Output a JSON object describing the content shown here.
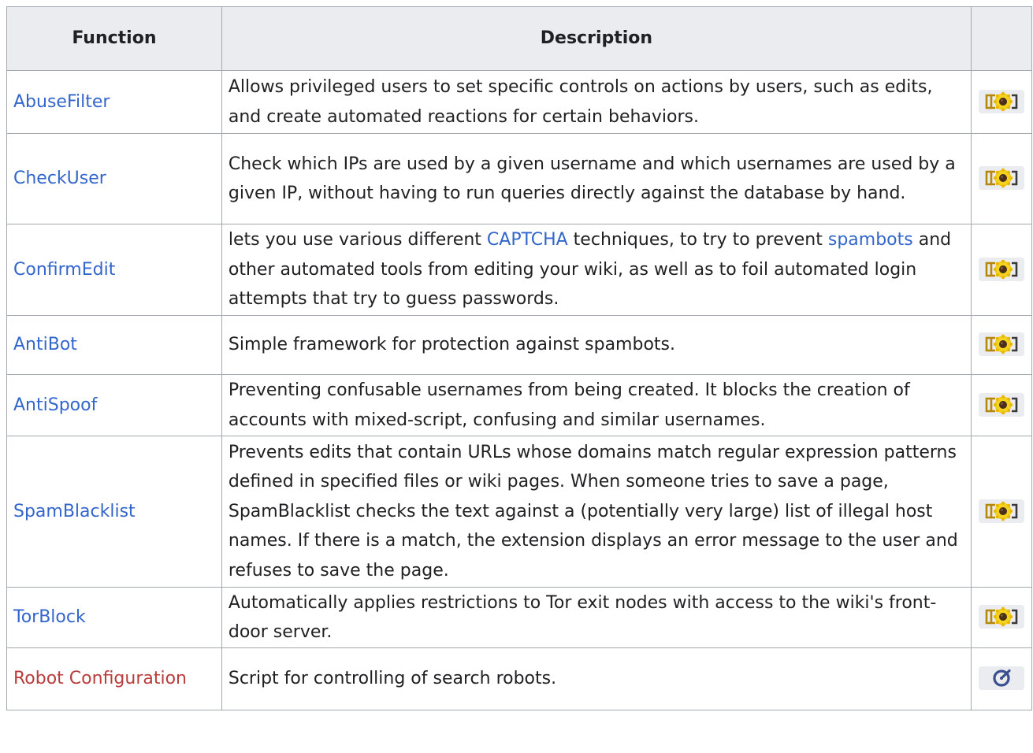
{
  "table": {
    "headers": {
      "function": "Function",
      "description": "Description",
      "extra": ""
    },
    "rows": [
      {
        "function": "AbuseFilter",
        "description": "Allows privileged users to set specific controls on actions by users, such as edits, and create automated reactions for certain behaviors.",
        "badge": "extension-icon"
      },
      {
        "function": "CheckUser",
        "description": "Check which IPs are used by a given username and which usernames are used by a given IP, without having to run queries directly against the database by hand.",
        "badge": "extension-icon"
      },
      {
        "function": "ConfirmEdit",
        "description_parts": {
          "a": "lets you use various different ",
          "link1": "CAPTCHA",
          "b": " techniques, to try to prevent ",
          "link2": "spambots",
          "c": " and other automated tools from editing your wiki, as well as to foil automated login attempts that try to guess passwords."
        },
        "badge": "extension-icon"
      },
      {
        "function": "AntiBot",
        "description": "Simple framework for protection against spambots.",
        "badge": "extension-icon"
      },
      {
        "function": "AntiSpoof",
        "description": "Preventing confusable usernames from being created. It blocks the creation of accounts with mixed-script, confusing and similar usernames.",
        "badge": "extension-icon"
      },
      {
        "function": "SpamBlacklist",
        "description": "Prevents edits that contain URLs whose domains match regular expression patterns defined in specified files or wiki pages. When someone tries to save a page, SpamBlacklist checks the text against a (potentially very large) list of illegal host names. If there is a match, the extension displays an error message to the user and refuses to save the page.",
        "badge": "extension-icon"
      },
      {
        "function": "TorBlock",
        "description": "Automatically applies restrictions to Tor exit nodes with access to the wiki's front-door server.",
        "badge": "extension-icon"
      },
      {
        "function": "Robot Configuration",
        "function_link_state": "missing-page",
        "description": "Script for controlling of search robots.",
        "badge": "gauge-icon"
      }
    ]
  },
  "colors": {
    "link": "#3366cc",
    "missing_link": "#ba3d3d",
    "header_bg": "#eaecf0",
    "border": "#a2a9b1",
    "badge_yellow": "#f2c81d"
  }
}
